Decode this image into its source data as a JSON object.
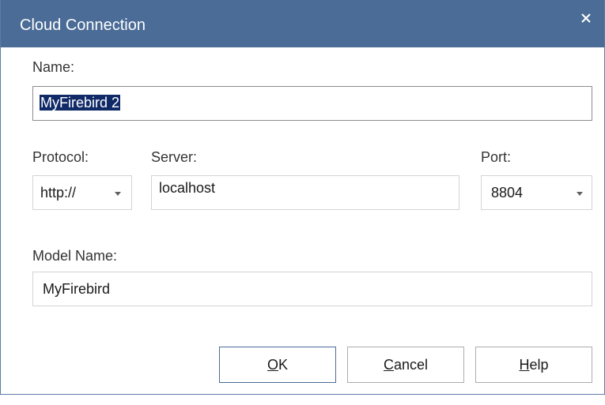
{
  "window": {
    "title": "Cloud Connection",
    "close_glyph": "✕"
  },
  "name": {
    "label": "Name:",
    "value": "MyFirebird 2"
  },
  "protocol": {
    "label": "Protocol:",
    "value": "http://"
  },
  "server": {
    "label": "Server:",
    "value": "localhost"
  },
  "port": {
    "label": "Port:",
    "value": "8804"
  },
  "model_name": {
    "label": "Model Name:",
    "value": "MyFirebird"
  },
  "buttons": {
    "ok": {
      "mnemonic": "O",
      "rest": "K"
    },
    "cancel": {
      "mnemonic": "C",
      "rest": "ancel"
    },
    "help": {
      "mnemonic": "H",
      "rest": "elp"
    }
  },
  "colors": {
    "titlebar": "#4a6c96",
    "selection": "#102a67"
  },
  "icons": {
    "close": "close-icon",
    "dropdown": "chevron-down-icon"
  }
}
